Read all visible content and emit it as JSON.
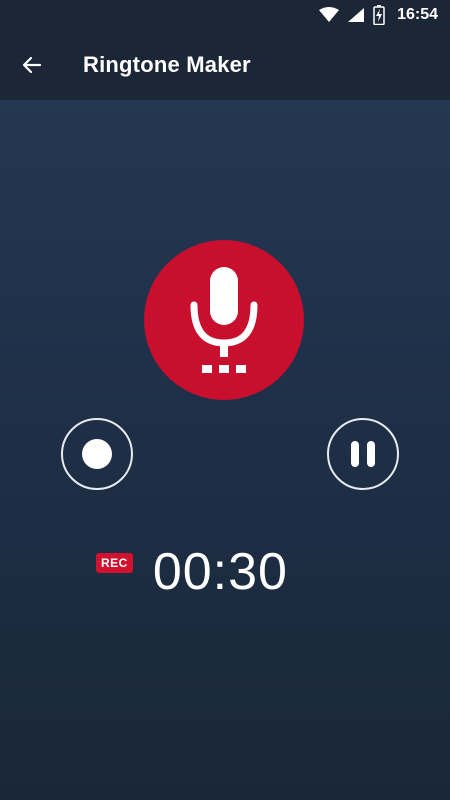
{
  "status_bar": {
    "time": "16:54",
    "icons": [
      "wifi-icon",
      "signal-icon",
      "battery-charging-icon"
    ]
  },
  "app_bar": {
    "title": "Ringtone Maker",
    "back_icon": "arrow-left-icon"
  },
  "recorder": {
    "mic_icon": "microphone-icon",
    "record_icon": "record-dot-icon",
    "pause_icon": "pause-icon",
    "rec_label": "REC",
    "elapsed": "00:30"
  },
  "colors": {
    "accent_red": "#c8102e",
    "app_bar_bg": "#1b2636",
    "background_top": "#263a57",
    "background_bottom": "#1a2738"
  }
}
